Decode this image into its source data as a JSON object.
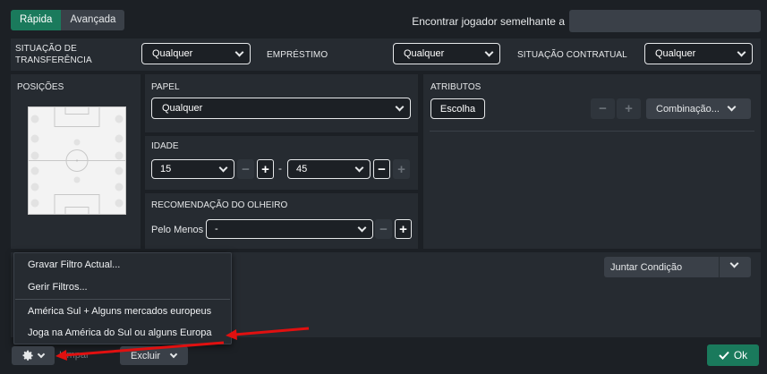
{
  "tabs": [
    {
      "label": "Rápida",
      "active": true
    },
    {
      "label": "Avançada",
      "active": false
    }
  ],
  "similar_player": {
    "label": "Encontrar jogador semelhante a",
    "value": ""
  },
  "filters": {
    "transfer_status": {
      "label": "SITUAÇÃO DE TRANSFERÊNCIA",
      "line1": "SITUAÇÃO DE",
      "line2": "TRANSFERÊNCIA",
      "value": "Qualquer"
    },
    "loan": {
      "label": "EMPRÉSTIMO",
      "value": "Qualquer"
    },
    "contract": {
      "label": "SITUAÇÃO CONTRATUAL",
      "value": "Qualquer"
    }
  },
  "positions": {
    "title": "POSIÇÕES"
  },
  "role": {
    "title": "PAPEL",
    "value": "Qualquer"
  },
  "age": {
    "title": "IDADE",
    "min": "15",
    "max": "45",
    "separator": "-",
    "minus": "−",
    "plus": "+"
  },
  "scout": {
    "title": "RECOMENDAÇÃO DO OLHEIRO",
    "prefix": "Pelo Menos",
    "value": "-"
  },
  "attributes": {
    "title": "ATRIBUTOS",
    "choose_label": "Escolha",
    "combination_label": "Combinação...",
    "minus": "−",
    "plus": "+"
  },
  "conditions": {
    "join_label": "Juntar Condição"
  },
  "menu": {
    "items": [
      "Gravar Filtro Actual...",
      "Gerir Filtros...",
      "América Sul + Alguns mercados europeus",
      "Joga na América do Sul ou alguns Europa"
    ]
  },
  "bottom": {
    "clear_label": "Limpar",
    "exclude_label": "Excluir",
    "ok_label": "Ok"
  },
  "colors": {
    "accent": "#1a7a5c",
    "annotation_arrow": "#e01010"
  }
}
